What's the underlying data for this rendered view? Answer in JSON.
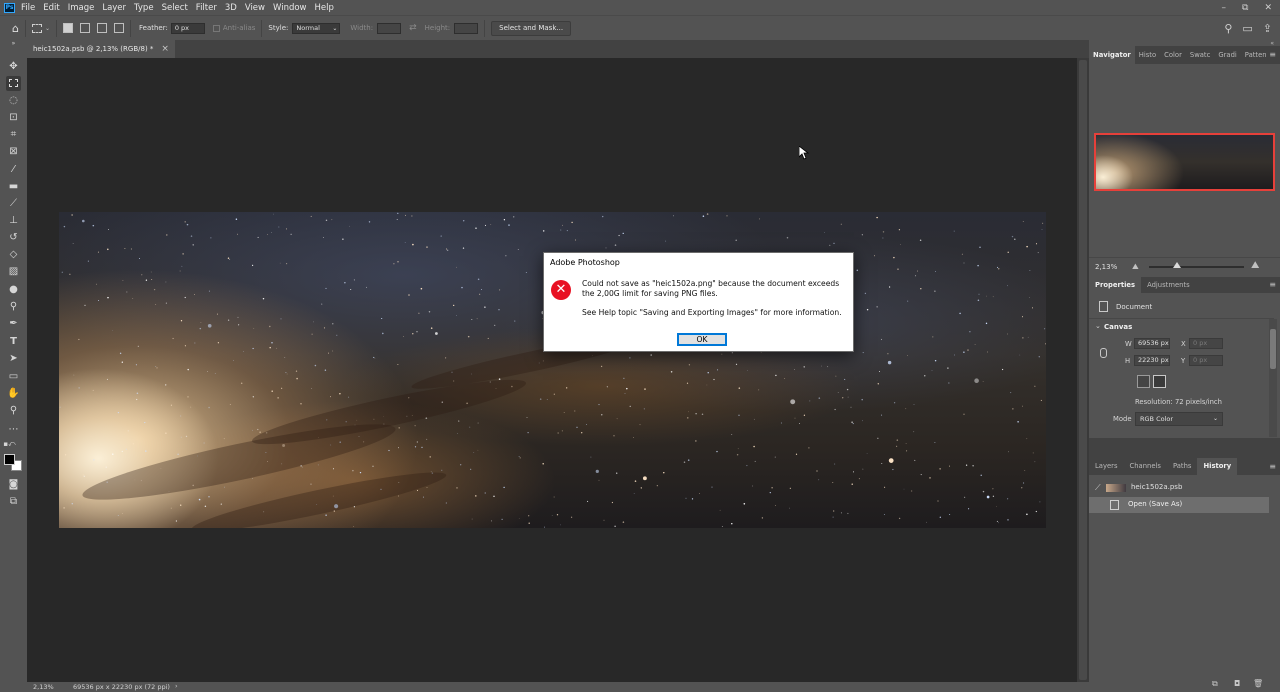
{
  "menubar": {
    "logo": "Ps",
    "items": [
      "File",
      "Edit",
      "Image",
      "Layer",
      "Type",
      "Select",
      "Filter",
      "3D",
      "View",
      "Window",
      "Help"
    ],
    "window_controls": [
      "–",
      "⧉",
      "✕"
    ]
  },
  "options": {
    "feather_label": "Feather:",
    "feather_value": "0 px",
    "antialias_label": "Anti-alias",
    "style_label": "Style:",
    "style_value": "Normal",
    "width_label": "Width:",
    "height_label": "Height:",
    "select_mask_label": "Select and Mask..."
  },
  "document": {
    "tab_title": "heic1502a.psb @ 2,13% (RGB/8) *",
    "close_glyph": "×"
  },
  "dialog": {
    "title": "Adobe Photoshop",
    "message": "Could not save as \"heic1502a.png\" because the document exceeds the 2,00G limit for saving PNG files.",
    "help": "See Help topic \"Saving and Exporting Images\" for more information.",
    "ok_label": "OK",
    "icon": "error-icon"
  },
  "navigator": {
    "tabs": [
      "Navigator",
      "Histo",
      "Color",
      "Swatc",
      "Gradi",
      "Patten"
    ],
    "zoom": "2,13%"
  },
  "properties": {
    "tabs": [
      "Properties",
      "Adjustments"
    ],
    "doc_label": "Document",
    "canvas_label": "Canvas",
    "w_label": "W",
    "w_value": "69536 px",
    "h_label": "H",
    "h_value": "22230 px",
    "x_label": "X",
    "x_value": "0 px",
    "y_label": "Y",
    "y_value": "0 px",
    "resolution": "Resolution: 72 pixels/inch",
    "mode_label": "Mode",
    "mode_value": "RGB Color"
  },
  "history": {
    "tabs": [
      "Layers",
      "Channels",
      "Paths",
      "History"
    ],
    "snapshot": "heic1502a.psb",
    "state": "Open (Save As)"
  },
  "status": {
    "zoom": "2,13%",
    "info": "69536 px x 22230 px (72 ppi)",
    "arrow": "›"
  }
}
